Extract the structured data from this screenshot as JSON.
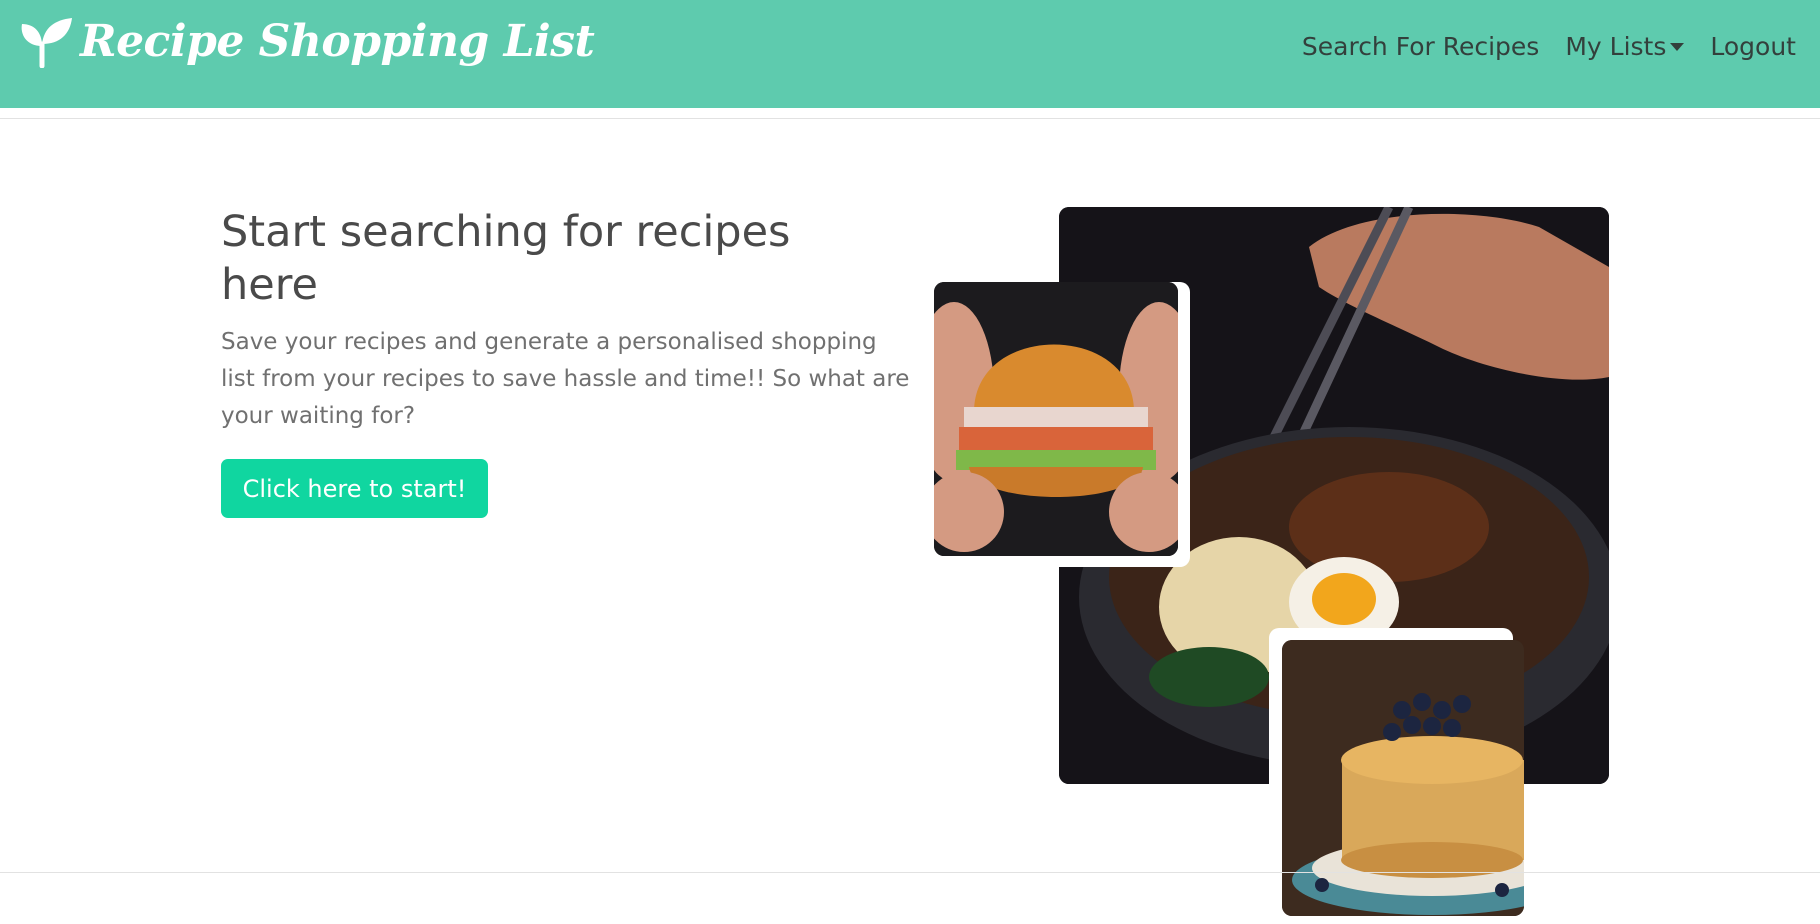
{
  "header": {
    "brand": "Recipe Shopping List",
    "nav": {
      "search": "Search For Recipes",
      "my_lists": "My Lists",
      "logout": "Logout"
    }
  },
  "hero": {
    "title": "Start searching for recipes here",
    "description": "Save your recipes and generate a personalised shopping list from your recipes to save hassle and time!! So what are your waiting for?",
    "cta_label": "Click here to start!"
  },
  "images": {
    "main": "noodle-bowl-with-chopsticks-image",
    "burger": "burger-image",
    "pancakes": "blueberry-pancakes-image"
  },
  "colors": {
    "navbar": "#5ecbae",
    "cta": "#10d6a0"
  }
}
